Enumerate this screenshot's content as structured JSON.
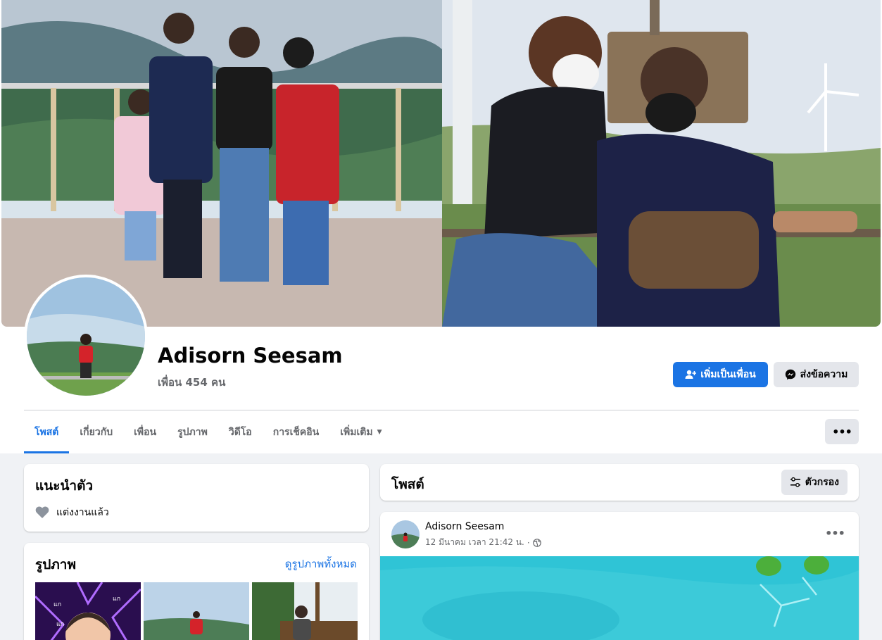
{
  "profile": {
    "name": "Adisorn Seesam",
    "friends": "เพื่อน 454 คน"
  },
  "actions": {
    "add_friend": "เพิ่มเป็นเพื่อน",
    "message": "ส่งข้อความ",
    "more": "•••"
  },
  "tabs": [
    {
      "label": "โพสต์",
      "active": true
    },
    {
      "label": "เกี่ยวกับ"
    },
    {
      "label": "เพื่อน"
    },
    {
      "label": "รูปภาพ"
    },
    {
      "label": "วิดีโอ"
    },
    {
      "label": "การเช็คอิน"
    },
    {
      "label": "เพิ่มเติม",
      "caret": "▼"
    }
  ],
  "intro": {
    "title": "แนะนำตัว",
    "relationship": "แต่งงานแล้ว",
    "relationship_icon": "heart-icon"
  },
  "photos": {
    "title": "รูปภาพ",
    "see_all": "ดูรูปภาพทั้งหมด"
  },
  "posts": {
    "title": "โพสต์",
    "filter": "ตัวกรอง",
    "items": [
      {
        "author": "Adisorn Seesam",
        "time": "12 มีนาคม เวลา 21:42 น.",
        "separator": "·",
        "privacy_icon": "globe-icon",
        "more": "•••"
      }
    ]
  },
  "colors": {
    "accent": "#1b74e4",
    "page_bg": "#f0f2f5",
    "secondary_text": "#65676b",
    "button_gray": "#e4e6eb"
  }
}
